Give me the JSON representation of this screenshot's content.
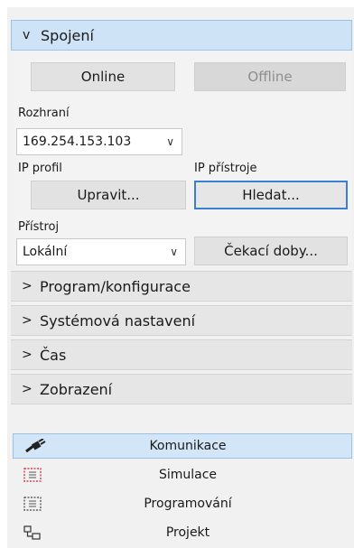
{
  "sections": {
    "connection": {
      "title": "Spojení",
      "chevron": "v"
    },
    "program": {
      "title": "Program/konfigurace",
      "chevron": ">"
    },
    "system": {
      "title": "Systémová nastavení",
      "chevron": ">"
    },
    "time": {
      "title": "Čas",
      "chevron": ">"
    },
    "display": {
      "title": "Zobrazení",
      "chevron": ">"
    }
  },
  "connection": {
    "online_label": "Online",
    "offline_label": "Offline",
    "interface_label": "Rozhraní",
    "interface_value": "169.254.153.103",
    "ip_profile_label": "IP profil",
    "ip_device_label": "IP přístroje",
    "edit_label": "Upravit...",
    "search_label": "Hledat...",
    "device_label": "Přístroj",
    "device_value": "Lokální",
    "timeouts_label": "Čekací doby..."
  },
  "nav": {
    "items": [
      {
        "label": "Komunikace",
        "icon": "plug-icon",
        "selected": true
      },
      {
        "label": "Simulace",
        "icon": "simulation-icon",
        "selected": false
      },
      {
        "label": "Programování",
        "icon": "programming-icon",
        "selected": false
      },
      {
        "label": "Projekt",
        "icon": "project-icon",
        "selected": false
      }
    ]
  },
  "colors": {
    "expanded_header": "#cfe3f6",
    "focus_border": "#3b7fd0",
    "selected_nav": "#d2e6f8"
  }
}
